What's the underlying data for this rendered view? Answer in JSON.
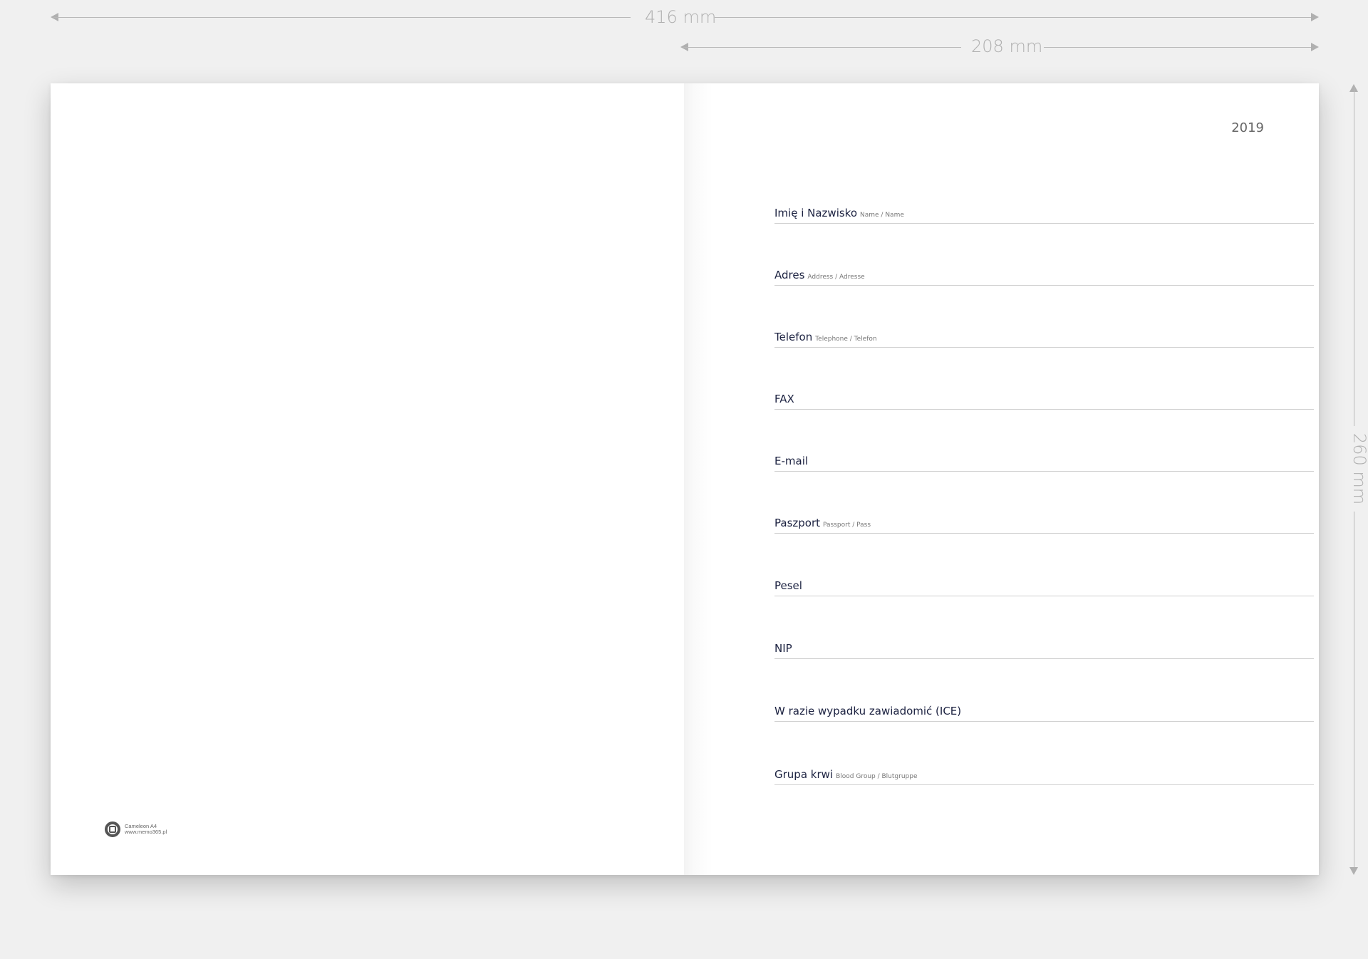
{
  "dimensions": {
    "width_total": "416 mm",
    "width_page": "208 mm",
    "height": "260 mm"
  },
  "left_page": {
    "logo": {
      "icon": "memo-logo-icon",
      "line1": "Cameleon A4",
      "line2": "www.memo365.pl"
    }
  },
  "right_page": {
    "year": "2019",
    "fields": [
      {
        "label": "Imię i Nazwisko",
        "sub": "Name / Name"
      },
      {
        "label": "Adres",
        "sub": "Address / Adresse"
      },
      {
        "label": "Telefon",
        "sub": "Telephone / Telefon"
      },
      {
        "label": "FAX",
        "sub": ""
      },
      {
        "label": "E-mail",
        "sub": ""
      },
      {
        "label": "Paszport",
        "sub": "Passport / Pass"
      },
      {
        "label": "Pesel",
        "sub": ""
      },
      {
        "label": "NIP",
        "sub": ""
      },
      {
        "label": "W razie wypadku zawiadomić (ICE)",
        "sub": ""
      },
      {
        "label": "Grupa krwi",
        "sub": "Blood Group / Blutgruppe"
      }
    ]
  }
}
